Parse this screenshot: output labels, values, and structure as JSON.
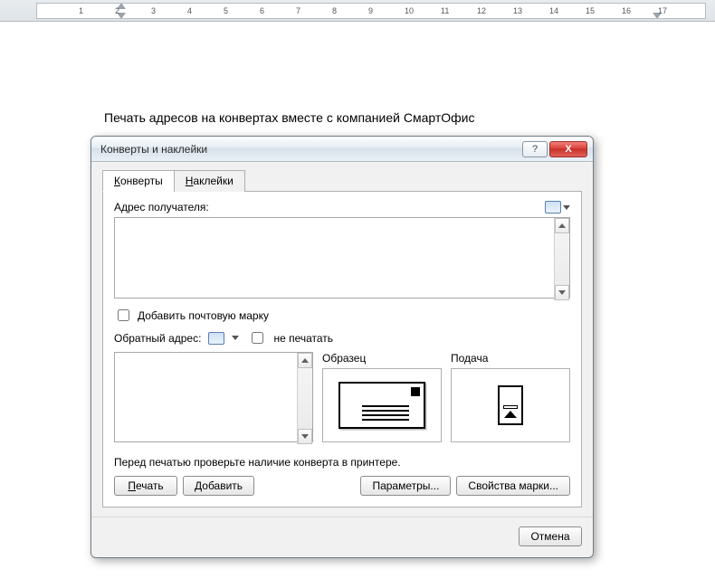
{
  "ruler": {
    "marks": [
      "1",
      "2",
      "3",
      "4",
      "5",
      "6",
      "7",
      "8",
      "9",
      "10",
      "11",
      "12",
      "13",
      "14",
      "15",
      "16",
      "17"
    ]
  },
  "document": {
    "heading": "Печать адресов на конвертах вместе с компанией СмартОфис"
  },
  "dialog": {
    "title": "Конверты и наклейки",
    "help_label": "?",
    "close_label": "X",
    "tabs": {
      "envelopes": "Конверты",
      "labels": "Наклейки"
    },
    "recipient": {
      "label": "Адрес получателя:",
      "value": ""
    },
    "add_stamp": {
      "label": "Добавить почтовую марку",
      "checked": false
    },
    "return_addr": {
      "label": "Обратный адрес:",
      "no_print_label": "не печатать",
      "no_print_checked": false,
      "value": ""
    },
    "preview": {
      "sample_label": "Образец",
      "feed_label": "Подача"
    },
    "hint": "Перед печатью проверьте наличие конверта в принтере.",
    "buttons": {
      "print": "Печать",
      "add": "Добавить",
      "options": "Параметры...",
      "stamp_props": "Свойства марки...",
      "cancel": "Отмена"
    }
  }
}
